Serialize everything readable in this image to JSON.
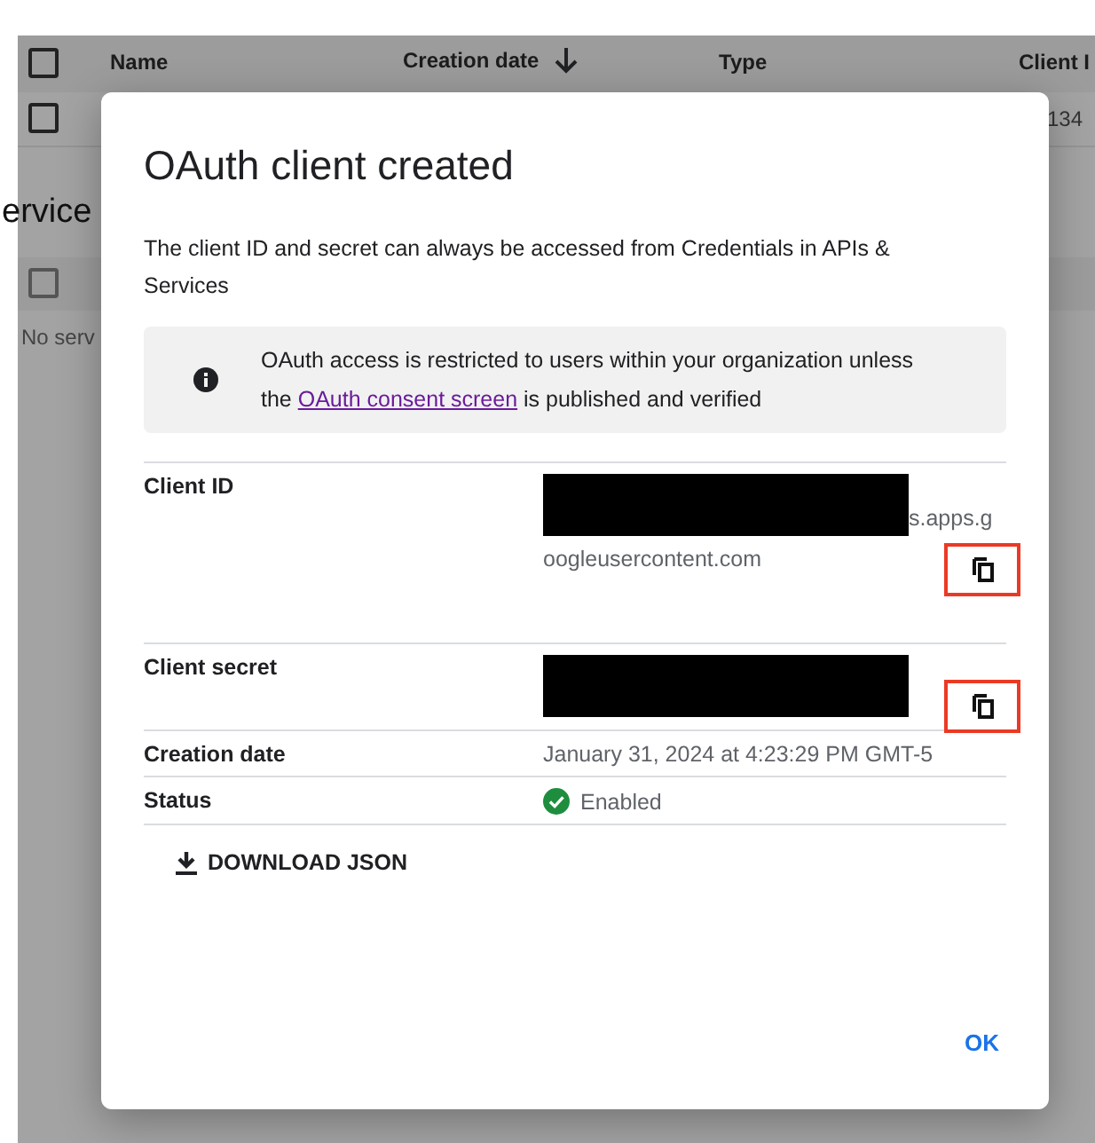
{
  "background": {
    "table": {
      "header_checked": false,
      "columns": [
        {
          "label": "Name",
          "sorted": false
        },
        {
          "label": "Creation date",
          "sorted": true
        },
        {
          "label": "Type",
          "sorted": false
        },
        {
          "label": "Client I",
          "sorted": false
        }
      ],
      "rows": [
        {
          "checked": false,
          "client_id": "134"
        }
      ]
    },
    "section": {
      "heading": "ervice",
      "header_checked": false,
      "empty_text": "No serv"
    }
  },
  "dialog": {
    "title": "OAuth client created",
    "description": "The client ID and secret can always be accessed from Credentials in APIs & Services",
    "notice": {
      "before": "OAuth access is restricted to users within your organization unless the ",
      "link": "OAuth consent screen",
      "after": " is published and verified"
    },
    "fields": [
      {
        "kind": "copyable",
        "label": "Client ID",
        "redacted": true,
        "value_lines": [
          "s.apps.g",
          "oogleusercontent.com"
        ],
        "copy_highlighted": true
      },
      {
        "kind": "copyable",
        "label": "Client secret",
        "redacted": true,
        "copy_highlighted": true
      },
      {
        "kind": "text",
        "label": "Creation date",
        "value": "January 31, 2024 at 4:23:29 PM GMT-5"
      },
      {
        "kind": "status",
        "label": "Status",
        "value": "Enabled",
        "enabled": true
      }
    ],
    "download_button": "DOWNLOAD JSON",
    "ok_button": "OK"
  }
}
